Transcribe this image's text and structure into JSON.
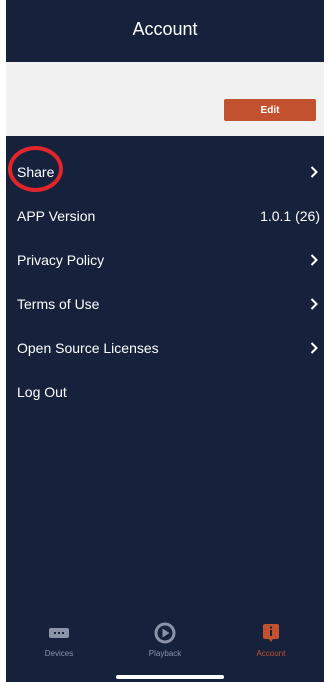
{
  "header": {
    "title": "Account"
  },
  "profile": {
    "edit_label": "Edit"
  },
  "menu": {
    "items": [
      {
        "label": "Share",
        "value": "",
        "chevron": true
      },
      {
        "label": "APP Version",
        "value": "1.0.1 (26)",
        "chevron": false
      },
      {
        "label": "Privacy Policy",
        "value": "",
        "chevron": true
      },
      {
        "label": "Terms of Use",
        "value": "",
        "chevron": true
      },
      {
        "label": "Open Source Licenses",
        "value": "",
        "chevron": true
      },
      {
        "label": "Log Out",
        "value": "",
        "chevron": false
      }
    ]
  },
  "tabbar": {
    "tabs": [
      {
        "label": "Devices",
        "icon": "devices-icon",
        "active": false
      },
      {
        "label": "Playback",
        "icon": "playback-icon",
        "active": false
      },
      {
        "label": "Account",
        "icon": "account-icon",
        "active": true
      }
    ]
  },
  "colors": {
    "background": "#16213b",
    "accent": "#c1512f",
    "profile_bg": "#f0f1f0",
    "annotation": "#e1262b",
    "inactive_tab": "#8a93a8"
  }
}
